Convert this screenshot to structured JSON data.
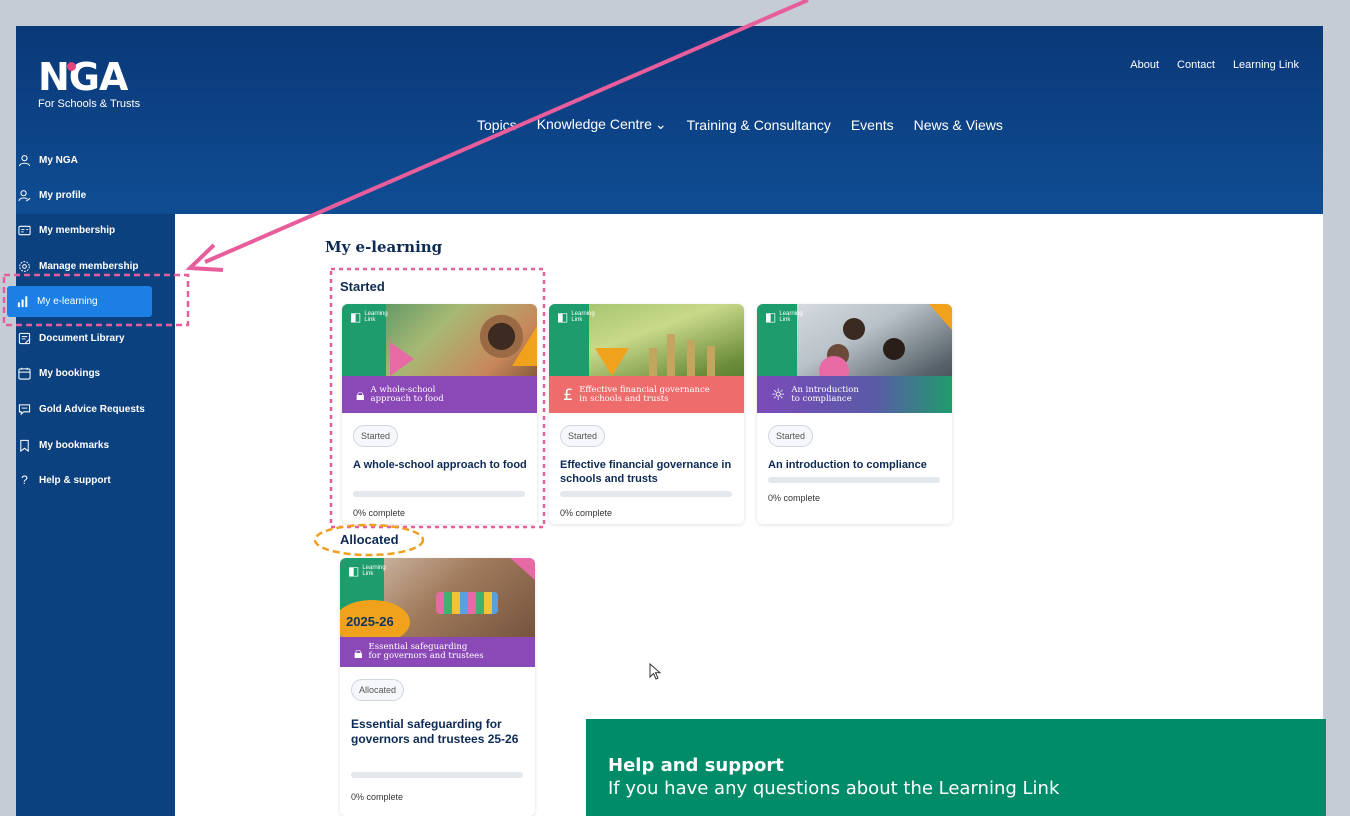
{
  "brand": {
    "logo_text": "NGA",
    "logo_sub": "For Schools & Trusts"
  },
  "util_nav": [
    "About",
    "Contact",
    "Learning Link"
  ],
  "main_nav": [
    "Topics",
    "Knowledge Centre",
    "Training & Consultancy",
    "Events",
    "News & Views"
  ],
  "sidebar": {
    "items": [
      {
        "label": "My NGA",
        "icon": "user-icon"
      },
      {
        "label": "My profile",
        "icon": "user-edit-icon"
      },
      {
        "label": "My membership",
        "icon": "id-card-icon"
      },
      {
        "label": "Manage membership",
        "icon": "gear-icon"
      },
      {
        "label": "My e-learning",
        "icon": "bar-chart-icon",
        "active": true
      },
      {
        "label": "Document Library",
        "icon": "document-icon"
      },
      {
        "label": "My bookings",
        "icon": "calendar-icon"
      },
      {
        "label": "Gold Advice Requests",
        "icon": "chat-icon"
      },
      {
        "label": "My bookmarks",
        "icon": "bookmark-icon"
      },
      {
        "label": "Help & support",
        "icon": "question-icon"
      }
    ]
  },
  "page": {
    "title": "My e-learning",
    "section_started": "Started",
    "section_allocated": "Allocated"
  },
  "cards": [
    {
      "badge_line1": "Learning",
      "badge_line2": "Link",
      "banner_line1": "A whole-school",
      "banner_line2": "approach to food",
      "banner_icon": "lock-icon",
      "status": "Started",
      "title": "A whole-school approach to food",
      "progress": 0,
      "progress_text": "0% complete",
      "strip_color": "#8b49b8"
    },
    {
      "badge_line1": "Learning",
      "badge_line2": "Link",
      "banner_line1": "Effective financial governance",
      "banner_line2": "in schools and trusts",
      "banner_icon": "pound-people-icon",
      "status": "Started",
      "title": "Effective financial governance in schools and trusts",
      "progress": 0,
      "progress_text": "0% complete",
      "strip_color": "#ef6c6c"
    },
    {
      "badge_line1": "Learning",
      "badge_line2": "Link",
      "banner_line1": "An introduction",
      "banner_line2": "to compliance",
      "banner_icon": "lightbulb-icon",
      "status": "Started",
      "title": "An introduction to compliance",
      "progress": 0,
      "progress_text": "0% complete",
      "strip_color": "#7a4bb8"
    },
    {
      "badge_line1": "Learning",
      "badge_line2": "Link",
      "year_tag": "2025-26",
      "banner_line1": "Essential safeguarding",
      "banner_line2": "for governors and trustees",
      "banner_icon": "lock-icon",
      "status": "Allocated",
      "title": "Essential safeguarding for governors and trustees 25-26",
      "progress": 0,
      "progress_text": "0% complete",
      "strip_color": "#8b49b8"
    }
  ],
  "help": {
    "title": "Help and support",
    "body": "If you have any questions about the Learning Link"
  },
  "colors": {
    "header_blue": "#0a3878",
    "sidebar_blue": "#0c417f",
    "active_blue": "#1c7fe3",
    "help_green": "#008b69",
    "annotation_pink": "#e85d9b",
    "annotation_orange": "#f0a020"
  }
}
